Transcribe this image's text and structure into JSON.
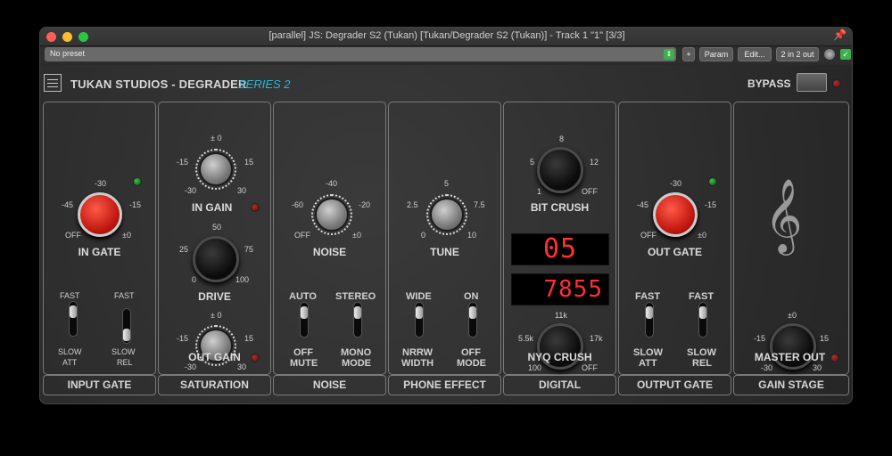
{
  "window": {
    "title": "[parallel] JS: Degrader S2 (Tukan) [Tukan/Degrader S2 (Tukan)] - Track 1 \"1\" [3/3]"
  },
  "toolbar": {
    "preset": "No preset",
    "plus": "+",
    "param": "Param",
    "edit": "Edit...",
    "io": "2 in 2 out"
  },
  "header": {
    "brand": "TUKAN STUDIOS  -  DEGRADER",
    "series": "SERIES 2",
    "bypass": "BYPASS"
  },
  "input_gate": {
    "k30": "-30",
    "k45": "-45",
    "k15": "-15",
    "off": "OFF",
    "pm0": "±0",
    "label": "IN GATE",
    "att_top": "FAST",
    "att_bottom1": "SLOW",
    "att_bottom2": "ATT",
    "rel_top": "FAST",
    "rel_bottom1": "SLOW",
    "rel_bottom2": "REL"
  },
  "saturation": {
    "ing_top": "± 0",
    "ing_m15": "-15",
    "ing_15": "15",
    "ing_m30": "-30",
    "ing_30": "30",
    "ing_label": "IN GAIN",
    "d50": "50",
    "d25": "25",
    "d75": "75",
    "d0": "0",
    "d100": "100",
    "drive_label": "DRIVE",
    "outg_top": "± 0",
    "outg_m15": "-15",
    "outg_15": "15",
    "outg_m30": "-30",
    "outg_30": "30",
    "outg_label": "OUT GAIN"
  },
  "noise": {
    "n40": "-40",
    "n60": "-60",
    "n20": "-20",
    "off": "OFF",
    "pm0": "±0",
    "label": "NOISE",
    "sw1_top": "AUTO",
    "sw1_b1": "OFF",
    "sw1_b2": "MUTE",
    "sw2_top": "STEREO",
    "sw2_b1": "MONO",
    "sw2_b2": "MODE"
  },
  "phone": {
    "t5": "5",
    "t25": "2.5",
    "t75": "7.5",
    "t0": "0",
    "t10": "10",
    "label": "TUNE",
    "sw1_top": "WIDE",
    "sw1_b1": "NRRW",
    "sw1_b2": "WIDTH",
    "sw2_top": "ON",
    "sw2_b1": "OFF",
    "sw2_b2": "MODE"
  },
  "digital": {
    "b8": "8",
    "b5": "5",
    "b12": "12",
    "b1": "1",
    "boff": "OFF",
    "bit_label": "BIT CRUSH",
    "display1": "05",
    "display2": "7855",
    "n11k": "11k",
    "n55k": "5.5k",
    "n17k": "17k",
    "n100": "100",
    "noff": "OFF",
    "nyq_label": "NYQ CRUSH"
  },
  "output_gate": {
    "k30": "-30",
    "k45": "-45",
    "k15": "-15",
    "off": "OFF",
    "pm0": "±0",
    "label": "OUT GATE",
    "att_top": "FAST",
    "att_bottom1": "SLOW",
    "att_bottom2": "ATT",
    "rel_top": "FAST",
    "rel_bottom1": "SLOW",
    "rel_bottom2": "REL"
  },
  "gain_stage": {
    "pm0": "±0",
    "m15": "-15",
    "p15": "15",
    "m30": "-30",
    "p30": "30",
    "label": "MASTER OUT"
  },
  "sections": [
    "INPUT GATE",
    "SATURATION",
    "NOISE",
    "PHONE EFFECT",
    "DIGITAL",
    "OUTPUT GATE",
    "GAIN STAGE"
  ]
}
